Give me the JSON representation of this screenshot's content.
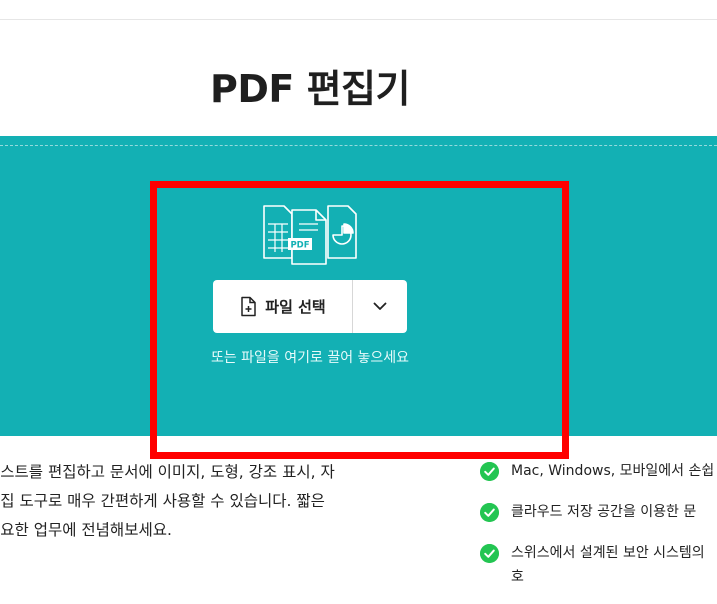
{
  "header": {
    "title": "PDF 편집기"
  },
  "dropzone": {
    "select_button_label": "파일 선택",
    "hint": "또는 파일을 여기로 끌어 놓으세요",
    "graphic_badge": "PDF",
    "background_color": "#13b0b4"
  },
  "description": {
    "lines": [
      "텍스트를 편집하고 문서에 이미지, 도형, 강조 표시, 자",
      "편집 도구로 매우 간편하게 사용할 수 있습니다. 짧은",
      "필요한 업무에 전념해보세요."
    ]
  },
  "features": [
    {
      "text": "Mac, Windows, 모바일에서 손쉽",
      "icon": "check-circle-icon"
    },
    {
      "text": "클라우드 저장 공간을 이용한 문",
      "icon": "check-circle-icon"
    },
    {
      "text": "스위스에서 설계된 보안 시스템의",
      "continuation": "호",
      "icon": "check-circle-icon"
    }
  ],
  "colors": {
    "accent": "#13b0b4",
    "check": "#23c552",
    "highlight": "#ff0000"
  }
}
